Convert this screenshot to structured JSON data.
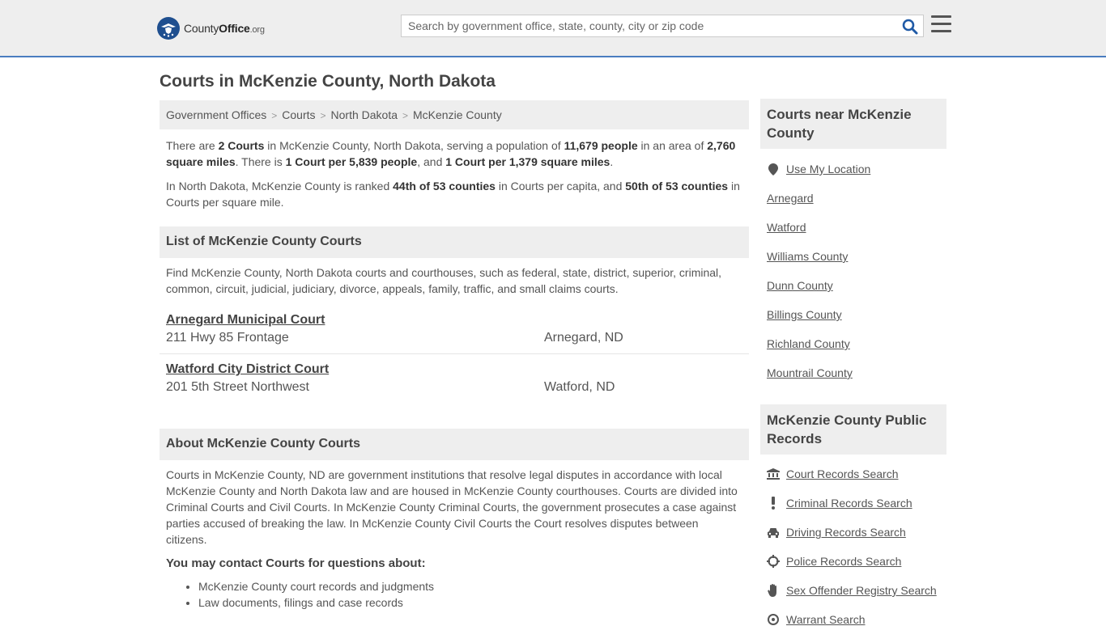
{
  "header": {
    "logo_text_prefix": "County",
    "logo_text_bold": "Office",
    "logo_text_suffix": ".org",
    "search_placeholder": "Search by government office, state, county, city or zip code"
  },
  "page_title": "Courts in McKenzie County, North Dakota",
  "breadcrumb": [
    "Government Offices",
    "Courts",
    "North Dakota",
    "McKenzie County"
  ],
  "intro": {
    "p1": [
      {
        "t": "There are ",
        "b": false
      },
      {
        "t": "2 Courts",
        "b": true
      },
      {
        "t": " in McKenzie County, North Dakota, serving a population of ",
        "b": false
      },
      {
        "t": "11,679 people",
        "b": true
      },
      {
        "t": " in an area of ",
        "b": false
      },
      {
        "t": "2,760 square miles",
        "b": true
      },
      {
        "t": ". There is ",
        "b": false
      },
      {
        "t": "1 Court per 5,839 people",
        "b": true
      },
      {
        "t": ", and ",
        "b": false
      },
      {
        "t": "1 Court per 1,379 square miles",
        "b": true
      },
      {
        "t": ".",
        "b": false
      }
    ],
    "p2": [
      {
        "t": "In North Dakota, McKenzie County is ranked ",
        "b": false
      },
      {
        "t": "44th of 53 counties",
        "b": true
      },
      {
        "t": " in Courts per capita, and ",
        "b": false
      },
      {
        "t": "50th of 53 counties",
        "b": true
      },
      {
        "t": " in Courts per square mile.",
        "b": false
      }
    ]
  },
  "list_section": {
    "title": "List of McKenzie County Courts",
    "description": "Find McKenzie County, North Dakota courts and courthouses, such as federal, state, district, superior, criminal, common, circuit, judicial, judiciary, divorce, appeals, family, traffic, and small claims courts.",
    "courts": [
      {
        "name": "Arnegard Municipal Court",
        "address": "211 Hwy 85 Frontage",
        "city": "Arnegard, ND"
      },
      {
        "name": "Watford City District Court",
        "address": "201 5th Street Northwest",
        "city": "Watford, ND"
      }
    ]
  },
  "about_section": {
    "title": "About McKenzie County Courts",
    "text": "Courts in McKenzie County, ND are government institutions that resolve legal disputes in accordance with local McKenzie County and North Dakota law and are housed in McKenzie County courthouses. Courts are divided into Criminal Courts and Civil Courts. In McKenzie County Criminal Courts, the government prosecutes a case against parties accused of breaking the law. In McKenzie County Civil Courts the Court resolves disputes between citizens.",
    "contact_heading": "You may contact Courts for questions about:",
    "topics": [
      "McKenzie County court records and judgments",
      "Law documents, filings and case records"
    ]
  },
  "sidebar": {
    "nearby_title": "Courts near McKenzie County",
    "use_location": "Use My Location",
    "nearby_links": [
      "Arnegard",
      "Watford",
      "Williams County",
      "Dunn County",
      "Billings County",
      "Richland County",
      "Mountrail County"
    ],
    "records_title": "McKenzie County Public Records",
    "records_links": [
      {
        "label": "Court Records Search",
        "icon": "courthouse-icon"
      },
      {
        "label": "Criminal Records Search",
        "icon": "exclamation-icon"
      },
      {
        "label": "Driving Records Search",
        "icon": "car-icon"
      },
      {
        "label": "Police Records Search",
        "icon": "crosshair-icon"
      },
      {
        "label": "Sex Offender Registry Search",
        "icon": "hand-icon"
      },
      {
        "label": "Warrant Search",
        "icon": "target-icon"
      }
    ]
  }
}
